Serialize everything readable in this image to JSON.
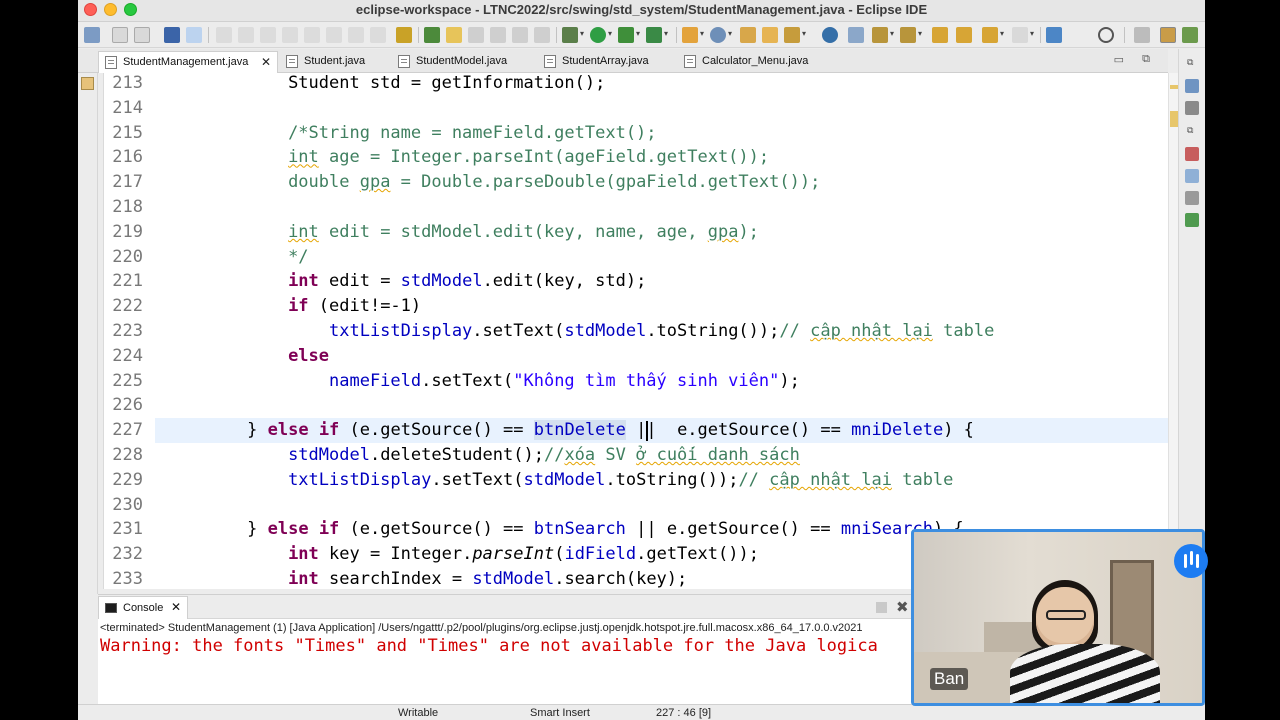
{
  "window": {
    "title": "eclipse-workspace - LTNC2022/src/swing/std_system/StudentManagement.java - Eclipse IDE"
  },
  "tabs": [
    {
      "label": "StudentManagement.java",
      "active": true
    },
    {
      "label": "Student.java"
    },
    {
      "label": "StudentModel.java"
    },
    {
      "label": "StudentArray.java"
    },
    {
      "label": "Calculator_Menu.java"
    }
  ],
  "editor": {
    "current_line": 227,
    "lines": [
      {
        "n": "213",
        "indent": "            ",
        "segs": [
          [
            "",
            "Student std = getInformation();"
          ]
        ]
      },
      {
        "n": "214",
        "indent": "",
        "segs": []
      },
      {
        "n": "215",
        "indent": "            ",
        "segs": [
          [
            "cm",
            "/*String name = nameField.getText();"
          ]
        ]
      },
      {
        "n": "216",
        "indent": "            ",
        "segs": [
          [
            "cm sq",
            "int"
          ],
          [
            "cm",
            " age = Integer.parseInt(ageField.getText());"
          ]
        ]
      },
      {
        "n": "217",
        "indent": "            ",
        "segs": [
          [
            "cm",
            "double "
          ],
          [
            "cm sq",
            "gpa"
          ],
          [
            "cm",
            " = Double.parseDouble(gpaField.getText());"
          ]
        ]
      },
      {
        "n": "218",
        "indent": "",
        "segs": []
      },
      {
        "n": "219",
        "indent": "            ",
        "segs": [
          [
            "cm sq",
            "int"
          ],
          [
            "cm",
            " edit = stdModel.edit(key, name, age, "
          ],
          [
            "cm sq",
            "gpa"
          ],
          [
            "cm",
            ");"
          ]
        ]
      },
      {
        "n": "220",
        "indent": "            ",
        "segs": [
          [
            "cm",
            "*/"
          ]
        ]
      },
      {
        "n": "221",
        "indent": "            ",
        "segs": [
          [
            "kw",
            "int"
          ],
          [
            "",
            " edit = "
          ],
          [
            "fld",
            "stdModel"
          ],
          [
            "",
            ".edit(key, std);"
          ]
        ]
      },
      {
        "n": "222",
        "indent": "            ",
        "segs": [
          [
            "kw",
            "if"
          ],
          [
            "",
            " (edit!=-1)"
          ]
        ]
      },
      {
        "n": "223",
        "indent": "                ",
        "segs": [
          [
            "fld",
            "txtListDisplay"
          ],
          [
            "",
            ".setText("
          ],
          [
            "fld",
            "stdModel"
          ],
          [
            "",
            ".toString());"
          ],
          [
            "cm",
            "// "
          ],
          [
            "cm sq",
            "cập nhật lại"
          ],
          [
            "cm",
            " table"
          ]
        ]
      },
      {
        "n": "224",
        "indent": "            ",
        "segs": [
          [
            "kw",
            "else"
          ]
        ]
      },
      {
        "n": "225",
        "indent": "                ",
        "segs": [
          [
            "fld",
            "nameField"
          ],
          [
            "",
            ".setText("
          ],
          [
            "str",
            "\"Không tìm thấy sinh viên\""
          ],
          [
            "",
            ");"
          ]
        ]
      },
      {
        "n": "226",
        "indent": "",
        "segs": []
      },
      {
        "n": "227",
        "indent": "        ",
        "segs": [
          [
            "",
            "} "
          ],
          [
            "kw",
            "else"
          ],
          [
            "",
            " "
          ],
          [
            "kw",
            "if"
          ],
          [
            "",
            " (e.getSource() == "
          ],
          [
            "fld hl",
            "btnDelete"
          ],
          [
            "",
            " ||  e.getSource() == "
          ],
          [
            "fld",
            "mniDelete"
          ],
          [
            "",
            ") {"
          ]
        ]
      },
      {
        "n": "228",
        "indent": "            ",
        "segs": [
          [
            "fld",
            "stdModel"
          ],
          [
            "",
            ".deleteStudent();"
          ],
          [
            "cm",
            "//"
          ],
          [
            "cm sq",
            "xóa"
          ],
          [
            "cm",
            " SV "
          ],
          [
            "cm sq",
            "ở cuối danh sách"
          ]
        ]
      },
      {
        "n": "229",
        "indent": "            ",
        "segs": [
          [
            "fld",
            "txtListDisplay"
          ],
          [
            "",
            ".setText("
          ],
          [
            "fld",
            "stdModel"
          ],
          [
            "",
            ".toString());"
          ],
          [
            "cm",
            "// "
          ],
          [
            "cm sq",
            "cập nhật lại"
          ],
          [
            "cm",
            " table"
          ]
        ]
      },
      {
        "n": "230",
        "indent": "",
        "segs": []
      },
      {
        "n": "231",
        "indent": "        ",
        "segs": [
          [
            "",
            "} "
          ],
          [
            "kw",
            "else"
          ],
          [
            "",
            " "
          ],
          [
            "kw",
            "if"
          ],
          [
            "",
            " (e.getSource() == "
          ],
          [
            "fld",
            "btnSearch"
          ],
          [
            "",
            " || e.getSource() == "
          ],
          [
            "fld",
            "mniSearch"
          ],
          [
            "",
            ") {"
          ]
        ]
      },
      {
        "n": "232",
        "indent": "            ",
        "segs": [
          [
            "kw",
            "int"
          ],
          [
            "",
            " key = Integer."
          ],
          [
            "st",
            "parseInt"
          ],
          [
            "",
            "("
          ],
          [
            "fld",
            "idField"
          ],
          [
            "",
            ".getText());"
          ]
        ]
      },
      {
        "n": "233",
        "indent": "            ",
        "segs": [
          [
            "kw",
            "int"
          ],
          [
            "",
            " searchIndex = "
          ],
          [
            "fld",
            "stdModel"
          ],
          [
            "",
            ".search(key);"
          ]
        ]
      }
    ]
  },
  "console": {
    "tab_label": "Console",
    "terminated": "<terminated> StudentManagement (1) [Java Application] /Users/ngattt/.p2/pool/plugins/org.eclipse.justj.openjdk.hotspot.jre.full.macosx.x86_64_17.0.0.v2021",
    "warning": "Warning: the fonts \"Times\" and \"Times\" are not available for the Java logica"
  },
  "statusbar": {
    "mode": "Writable",
    "insert": "Smart Insert",
    "position": "227 : 46 [9]"
  },
  "webcam": {
    "caption": "Ban"
  }
}
